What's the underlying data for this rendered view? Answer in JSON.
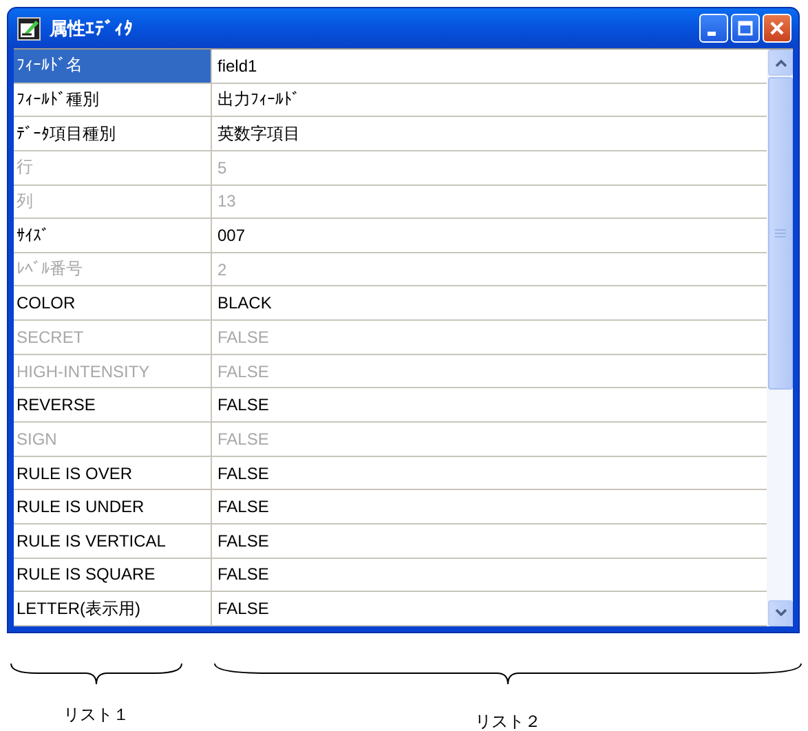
{
  "window": {
    "title": "属性ｴﾃﾞｨﾀ"
  },
  "rows": [
    {
      "name": "ﾌｨｰﾙﾄﾞ名",
      "value": "field1",
      "disabled": false,
      "selected": true
    },
    {
      "name": "ﾌｨｰﾙﾄﾞ種別",
      "value": "出力ﾌｨｰﾙﾄﾞ",
      "disabled": false,
      "selected": false
    },
    {
      "name": "ﾃﾞｰﾀ項目種別",
      "value": "英数字項目",
      "disabled": false,
      "selected": false
    },
    {
      "name": "行",
      "value": "5",
      "disabled": true,
      "selected": false
    },
    {
      "name": "列",
      "value": "13",
      "disabled": true,
      "selected": false
    },
    {
      "name": "ｻｲｽﾞ",
      "value": "007",
      "disabled": false,
      "selected": false
    },
    {
      "name": "ﾚﾍﾞﾙ番号",
      "value": "2",
      "disabled": true,
      "selected": false
    },
    {
      "name": "COLOR",
      "value": "BLACK",
      "disabled": false,
      "selected": false
    },
    {
      "name": "SECRET",
      "value": "FALSE",
      "disabled": true,
      "selected": false
    },
    {
      "name": "HIGH-INTENSITY",
      "value": "FALSE",
      "disabled": true,
      "selected": false
    },
    {
      "name": "REVERSE",
      "value": "FALSE",
      "disabled": false,
      "selected": false
    },
    {
      "name": "SIGN",
      "value": "FALSE",
      "disabled": true,
      "selected": false
    },
    {
      "name": "RULE IS OVER",
      "value": "FALSE",
      "disabled": false,
      "selected": false
    },
    {
      "name": "RULE IS UNDER",
      "value": "FALSE",
      "disabled": false,
      "selected": false
    },
    {
      "name": "RULE IS VERTICAL",
      "value": "FALSE",
      "disabled": false,
      "selected": false
    },
    {
      "name": "RULE IS SQUARE",
      "value": "FALSE",
      "disabled": false,
      "selected": false
    },
    {
      "name": "LETTER(表示用)",
      "value": "FALSE",
      "disabled": false,
      "selected": false
    }
  ],
  "annotations": [
    {
      "label": "リスト１"
    },
    {
      "label": "リスト２"
    }
  ]
}
